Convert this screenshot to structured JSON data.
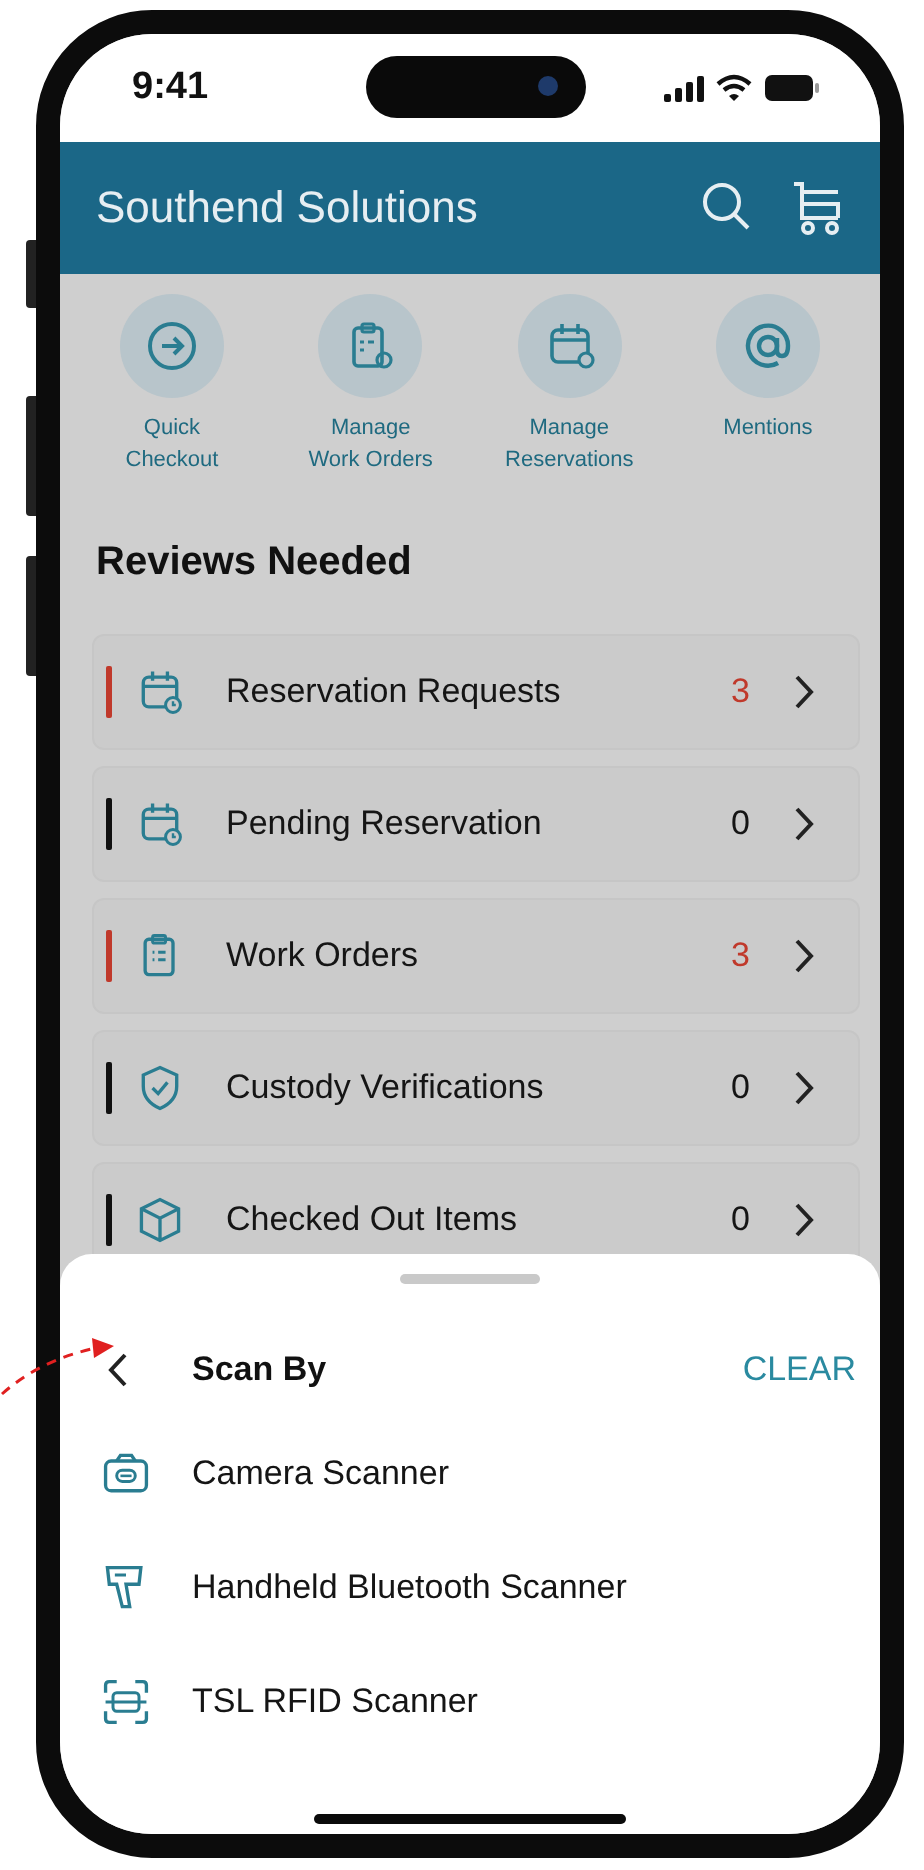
{
  "status_bar": {
    "time": "9:41"
  },
  "header": {
    "title": "Southend Solutions"
  },
  "quick_actions": [
    {
      "kind": "checkout",
      "label": "Quick\nCheckout"
    },
    {
      "kind": "work-orders",
      "label": "Manage\nWork Orders"
    },
    {
      "kind": "reservations",
      "label": "Manage\nReservations"
    },
    {
      "kind": "mentions",
      "label": "Mentions"
    }
  ],
  "reviews": {
    "title": "Reviews Needed",
    "items": [
      {
        "kind": "reservation",
        "label": "Reservation Requests",
        "count": "3",
        "urgent": true,
        "color": "#c0392b"
      },
      {
        "kind": "reservation",
        "label": "Pending Reservation",
        "count": "0",
        "urgent": false,
        "color": "#111111"
      },
      {
        "kind": "work-order",
        "label": "Work Orders",
        "count": "3",
        "urgent": true,
        "color": "#c0392b"
      },
      {
        "kind": "custody",
        "label": "Custody Verifications",
        "count": "0",
        "urgent": false,
        "color": "#111111"
      },
      {
        "kind": "checkout",
        "label": "Checked Out Items",
        "count": "0",
        "urgent": false,
        "color": "#111111"
      }
    ]
  },
  "sheet": {
    "title": "Scan By",
    "action": "CLEAR",
    "options": [
      {
        "kind": "camera",
        "label": "Camera Scanner"
      },
      {
        "kind": "handheld",
        "label": "Handheld Bluetooth Scanner"
      },
      {
        "kind": "rfid",
        "label": "TSL RFID Scanner"
      }
    ]
  }
}
